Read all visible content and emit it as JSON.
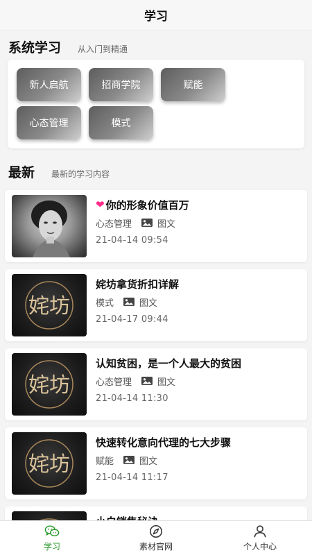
{
  "header": {
    "title": "学习"
  },
  "system": {
    "title": "系统学习",
    "subtitle": "从入门到精通",
    "categories": [
      {
        "label": "新人启航"
      },
      {
        "label": "招商学院"
      },
      {
        "label": "赋能"
      },
      {
        "label": "心态管理"
      },
      {
        "label": "模式"
      }
    ]
  },
  "latest": {
    "title": "最新",
    "subtitle": "最新的学习内容",
    "articles": [
      {
        "title": "你的形象价值百万",
        "category": "心态管理",
        "type": "图文",
        "time": "21-04-14 09:54",
        "thumb": "portrait"
      },
      {
        "title": "姹坊拿货折扣详解",
        "category": "模式",
        "type": "图文",
        "time": "21-04-17 09:44",
        "thumb": "logo"
      },
      {
        "title": "认知贫困，是一个人最大的贫困",
        "category": "心态管理",
        "type": "图文",
        "time": "21-04-14 11:30",
        "thumb": "logo"
      },
      {
        "title": "快速转化意向代理的七大步骤",
        "category": "赋能",
        "type": "图文",
        "time": "21-04-14 11:17",
        "thumb": "logo"
      },
      {
        "title": "小白销售秘诀",
        "category": "",
        "type": "",
        "time": "",
        "thumb": "logo"
      }
    ]
  },
  "tabbar": {
    "items": [
      {
        "label": "学习",
        "icon": "chat-bubbles-icon",
        "active": true
      },
      {
        "label": "素材官网",
        "icon": "compass-icon",
        "active": false
      },
      {
        "label": "个人中心",
        "icon": "user-icon",
        "active": false
      }
    ]
  },
  "colors": {
    "active_tab": "#2f9a2f",
    "heart": "#ff2a8a"
  }
}
